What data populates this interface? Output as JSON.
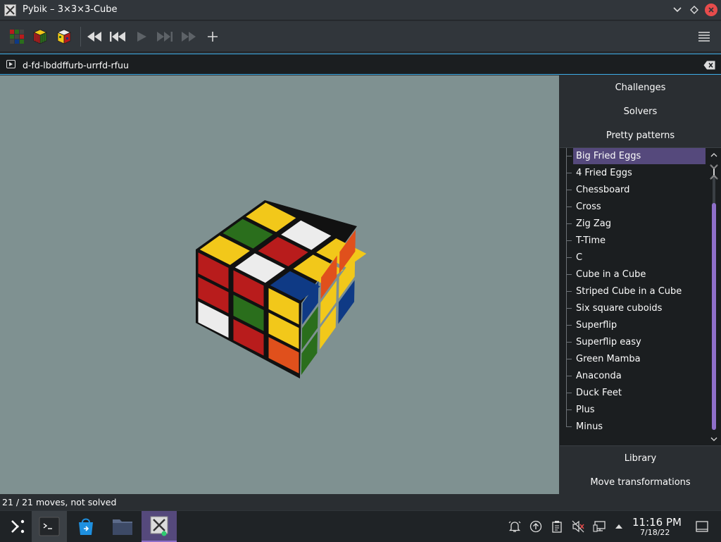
{
  "window": {
    "title": "Pybik – 3×3×3-Cube",
    "buttons": {
      "minimize": "chevron-down-icon",
      "keep_above": "diamond-icon",
      "close": "close-icon"
    }
  },
  "toolbar": {
    "items": [
      "new-random-cube-icon",
      "new-solved-cube-icon",
      "select-puzzle-icon",
      "rewind-icon",
      "previous-icon",
      "play-icon",
      "next-icon",
      "forward-icon",
      "add-mark-icon"
    ],
    "menu": "hamburger-menu-icon"
  },
  "moves_field": {
    "value": "d-fd-lbddffurb-urrfd-rfuu"
  },
  "sidebar": {
    "sections_top": [
      "Challenges",
      "Solvers",
      "Pretty patterns"
    ],
    "patterns": [
      "Big Fried Eggs",
      "4 Fried Eggs",
      "Chessboard",
      "Cross",
      "Zig Zag",
      "T-Time",
      "C",
      "Cube in a Cube",
      "Striped Cube in a Cube",
      "Six square cuboids",
      "Superflip",
      "Superflip easy",
      "Green Mamba",
      "Anaconda",
      "Duck Feet",
      "Plus",
      "Minus"
    ],
    "selected_index": 0,
    "sections_bottom": [
      "Library",
      "Move transformations"
    ]
  },
  "status": {
    "text": "21 / 21 moves, not solved"
  },
  "cube": {
    "colors": {
      "R": "#b81c1c",
      "G": "#2a6e1c",
      "B": "#0f3a85",
      "Y": "#f2c81a",
      "W": "#ececec",
      "O": "#e0501c"
    },
    "top": [
      [
        "Y",
        "G",
        "Y"
      ],
      [
        "W",
        "R",
        "W"
      ],
      [
        "B",
        "Y",
        "Y"
      ]
    ],
    "left": [
      [
        "R",
        "R",
        "Y"
      ],
      [
        "R",
        "G",
        "Y"
      ],
      [
        "W",
        "R",
        "O"
      ]
    ],
    "right": [
      [
        "B",
        "O",
        "O"
      ],
      [
        "G",
        "Y",
        "Y"
      ],
      [
        "G",
        "Y",
        "B"
      ]
    ]
  },
  "taskbar": {
    "apps": [
      "app-launcher-icon",
      "terminal-icon",
      "discover-icon",
      "files-icon",
      "pybik-icon"
    ],
    "tray": [
      "notifications-icon",
      "updates-icon",
      "clipboard-icon",
      "volume-muted-icon",
      "network-icon",
      "expand-tray-icon"
    ],
    "time": "11:16 PM",
    "date": "7/18/22",
    "show_desktop": "show-desktop-icon"
  }
}
